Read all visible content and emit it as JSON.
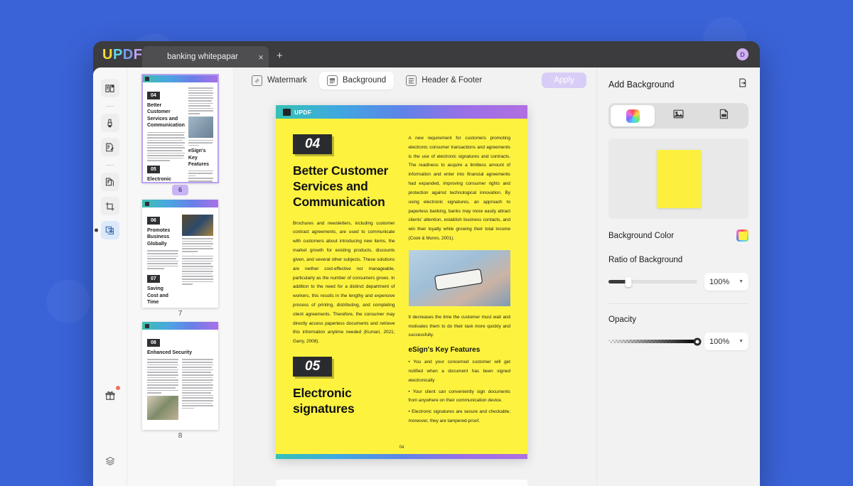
{
  "app": {
    "logo_letters": [
      "U",
      "P",
      "D",
      "F"
    ],
    "avatar_initial": "D"
  },
  "tabs": {
    "items": [
      {
        "label": "banking whitepapar",
        "close": "×"
      }
    ],
    "new_tab": "+"
  },
  "rail": {
    "items": [
      {
        "name": "reader-view",
        "icon": "book-icon"
      },
      {
        "name": "annotate",
        "icon": "highlighter-icon"
      },
      {
        "name": "edit-pdf",
        "icon": "edit-document-icon"
      },
      {
        "name": "organize-pages",
        "icon": "pages-icon"
      },
      {
        "name": "crop-pages",
        "icon": "crop-icon"
      },
      {
        "name": "batch-watermark",
        "icon": "stamp-icon"
      }
    ],
    "bottom": [
      {
        "name": "gift",
        "icon": "gift-icon"
      },
      {
        "name": "layers",
        "icon": "layers-icon"
      }
    ]
  },
  "thumbnails": [
    {
      "page_label": "6",
      "selected": true,
      "badge": true,
      "sections": [
        {
          "num": "04",
          "heading": "Better Customer\nServices and\nCommunication"
        },
        {
          "num": "05",
          "heading": "Electronic\nsignatures"
        }
      ],
      "sub_heading": "eSign's Key Features"
    },
    {
      "page_label": "7",
      "selected": false,
      "badge": false,
      "sections": [
        {
          "num": "06",
          "heading": "Promotes\nBusiness Globally"
        },
        {
          "num": "07",
          "heading": "Saving\nCost and Time"
        }
      ],
      "sub_heading": ""
    },
    {
      "page_label": "8",
      "selected": false,
      "badge": false,
      "sections": [
        {
          "num": "08",
          "heading": "Enhanced Security"
        }
      ],
      "sub_heading": ""
    }
  ],
  "toolbar": {
    "watermark": "Watermark",
    "background": "Background",
    "header_footer": "Header & Footer",
    "apply": "Apply"
  },
  "document": {
    "brand": "UPDF",
    "section_one": {
      "number": "04",
      "title": "Better Customer Services and Communication",
      "body": "Brochures and newsletters, including customer contract agreements, are used to communicate with customers about introducing new items, the market growth for existing products, discounts given, and several other subjects. These solutions are neither cost-effective nor manageable, particularly as the number of consumers grows. In addition to the need for a distinct department of workers, this results in the lengthy and expensive process of printing, distributing, and completing client agreements. Therefore, the consumer may directly access paperless documents and retrieve this information anytime needed (Kumari, 2021; Garry, 2008)."
    },
    "section_two": {
      "number": "05",
      "title": "Electronic signatures"
    },
    "right_column": {
      "paragraph": "A new requirement for customers promoting electronic consumer transactions and agreements is the use of electronic signatures and contracts. The readiness to acquire a limitless amount of information and enter into financial agreements had expanded, improving consumer rights and protection against technological innovation. By using electronic signatures, an approach to paperless banking, banks may more easily attract clients' attention, establish business contacts, and win their loyalty while growing their total income (Cook & Munro, 2001).",
      "after_image": "It decreases the time the customer must wait and motivates them to do their task more quickly and successfully.",
      "sub_heading": "eSign's Key Features",
      "bullets": [
        "• You and your concerned customer will get notified when a document has been signed electronically",
        "• Your client can conveniently sign documents from anywhere on their communication device.",
        "• Electronic signatures are secure and checkable; moreover, they are tampered-proof."
      ]
    },
    "page_number": "04"
  },
  "panel": {
    "title": "Add Background",
    "save_icon": "save-preset-icon",
    "tabs": [
      {
        "name": "color",
        "icon": "color-swatch-icon",
        "selected": true
      },
      {
        "name": "image",
        "icon": "image-icon",
        "selected": false
      },
      {
        "name": "file",
        "icon": "file-icon",
        "selected": false
      }
    ],
    "background_color_label": "Background Color",
    "background_color_value": "#FCEF3E",
    "ratio_label": "Ratio of Background",
    "ratio_value": "100%",
    "opacity_label": "Opacity",
    "opacity_value": "100%"
  }
}
